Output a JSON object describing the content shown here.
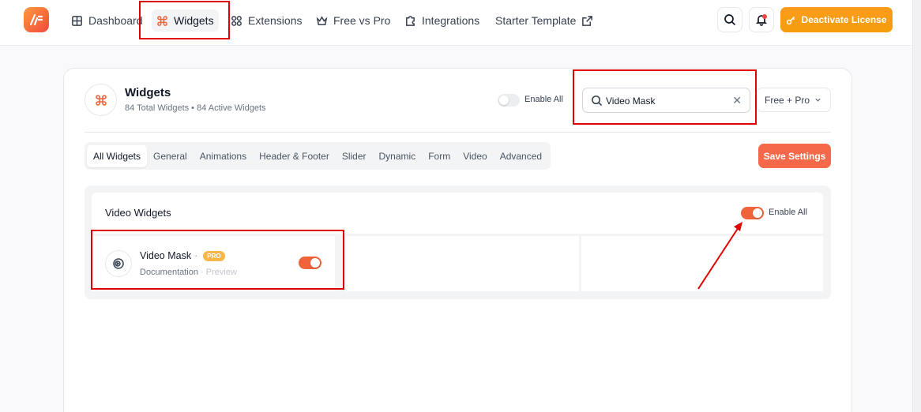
{
  "nav": {
    "items": [
      {
        "label": "Dashboard",
        "icon": "dashboard-icon"
      },
      {
        "label": "Widgets",
        "icon": "command-icon",
        "active": true
      },
      {
        "label": "Extensions",
        "icon": "extensions-icon"
      },
      {
        "label": "Free vs Pro",
        "icon": "crown-icon"
      },
      {
        "label": "Integrations",
        "icon": "puzzle-icon"
      },
      {
        "label": "Starter Template",
        "icon": "external-link-icon"
      }
    ],
    "deactivate_label": "Deactivate License"
  },
  "header": {
    "title": "Widgets",
    "subtitle": "84 Total Widgets • 84 Active Widgets",
    "enable_all_label": "Enable All",
    "enable_all_on": false,
    "search": {
      "value": "Video Mask",
      "placeholder": "Search"
    },
    "filter_label": "Free + Pro"
  },
  "tabs": [
    "All Widgets",
    "General",
    "Animations",
    "Header & Footer",
    "Slider",
    "Dynamic",
    "Form",
    "Video",
    "Advanced"
  ],
  "active_tab": "All Widgets",
  "save_label": "Save Settings",
  "section": {
    "title": "Video Widgets",
    "enable_all_label": "Enable All",
    "enable_all_on": true,
    "widgets": [
      {
        "name": "Video Mask",
        "badge": "PRO",
        "doc_label": "Documentation",
        "preview_label": "Preview",
        "enabled": true
      }
    ]
  },
  "colors": {
    "accent": "#f0643c",
    "deactivate": "#f59e0b",
    "annotation_red": "#e00000"
  }
}
